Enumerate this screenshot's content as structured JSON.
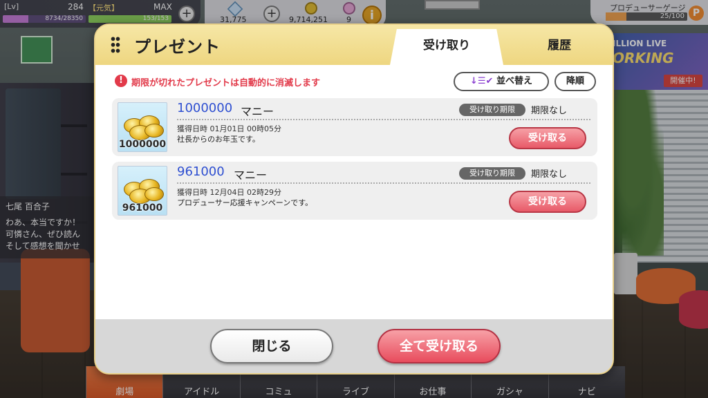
{
  "hud": {
    "lv_label": "[Lv]",
    "level": "284",
    "genki_label": "【元気】",
    "max_label": "MAX",
    "xp_text": "8734/28350",
    "xp_fraction": 0.31,
    "genki_text": "153/153",
    "genki_fraction": 1.0,
    "gems": "31,775",
    "money": "9,714,251",
    "tickets": "9",
    "info_glyph": "i",
    "plus_glyph": "+"
  },
  "gauge": {
    "title": "プロデューサーゲージ",
    "value_text": "25/100",
    "fraction": 0.25,
    "badge": "P"
  },
  "event": {
    "line1": "ILLION LIVE",
    "line2": "ORKING",
    "status": "開催中!"
  },
  "dialogue": {
    "speaker": "七尾 百合子",
    "text": "わあ、本当ですか！\n可憐さん、ぜひ読ん\nそして感想を聞かせ"
  },
  "nav": {
    "items": [
      "劇場",
      "アイドル",
      "コミュ",
      "ライブ",
      "お仕事",
      "ガシャ",
      "ナビ"
    ],
    "active_index": 0
  },
  "modal": {
    "title": "プレゼント",
    "tabs": [
      "受け取り",
      "履歴"
    ],
    "warning": "期限が切れたプレゼントは自動的に消滅します",
    "warning_icon": "!",
    "sort_icon": "↓☰✔",
    "sort_label": "並べ替え",
    "order_label": "降順",
    "items": [
      {
        "thumb_qty": "1000000",
        "amount": "1000000",
        "unit": "マニー",
        "deadline_tag": "受け取り期限",
        "deadline": "期限なし",
        "acquired": "獲得日時 01月01日 00時05分",
        "description": "社長からのお年玉です。",
        "button": "受け取る"
      },
      {
        "thumb_qty": "961000",
        "amount": "961000",
        "unit": "マニー",
        "deadline_tag": "受け取り期限",
        "deadline": "期限なし",
        "acquired": "獲得日時 12月04日 02時29分",
        "description": "プロデューサー応援キャンペーンです。",
        "button": "受け取る"
      }
    ],
    "close_label": "閉じる",
    "receive_all_label": "全て受け取る"
  },
  "colors": {
    "accent_red": "#e23a4a",
    "amount_blue": "#2e4fd1",
    "header_gold": "#eed680"
  }
}
